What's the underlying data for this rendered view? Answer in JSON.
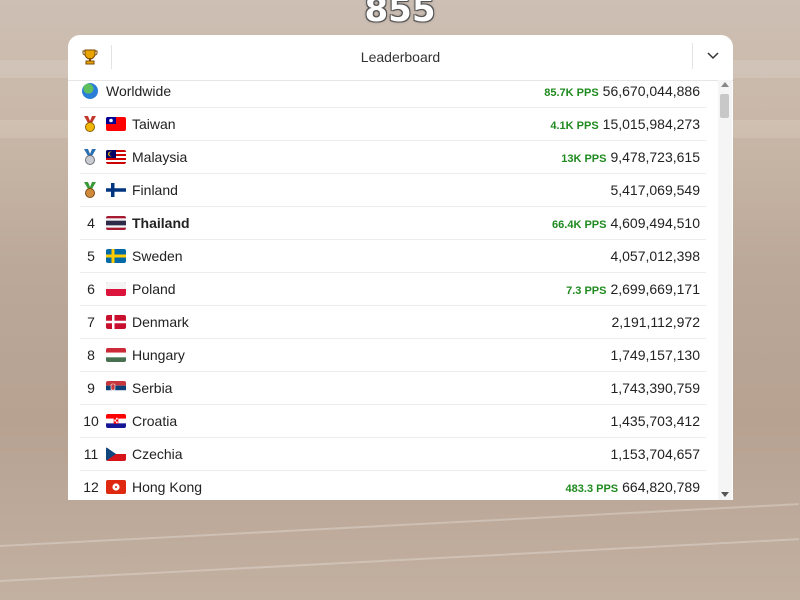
{
  "score": "855",
  "leaderboard": {
    "title": "Leaderboard",
    "icons": {
      "trophy": "trophy-icon",
      "collapse": "chevron-down-icon"
    },
    "colors": {
      "pps": "#1f8a1f"
    },
    "worldwide": {
      "name": "Worldwide",
      "pps": "85.7K PPS",
      "total": "56,670,044,886"
    },
    "rows": [
      {
        "rank": "",
        "medal": "gold",
        "flag": "taiwan",
        "name": "Taiwan",
        "pps": "4.1K PPS",
        "total": "15,015,984,273"
      },
      {
        "rank": "",
        "medal": "silver",
        "flag": "malaysia",
        "name": "Malaysia",
        "pps": "13K PPS",
        "total": "9,478,723,615"
      },
      {
        "rank": "",
        "medal": "bronze",
        "flag": "finland",
        "name": "Finland",
        "pps": "",
        "total": "5,417,069,549"
      },
      {
        "rank": "4",
        "medal": "",
        "flag": "thailand",
        "name": "Thailand",
        "pps": "66.4K PPS",
        "total": "4,609,494,510",
        "bold": true
      },
      {
        "rank": "5",
        "medal": "",
        "flag": "sweden",
        "name": "Sweden",
        "pps": "",
        "total": "4,057,012,398"
      },
      {
        "rank": "6",
        "medal": "",
        "flag": "poland",
        "name": "Poland",
        "pps": "7.3 PPS",
        "total": "2,699,669,171"
      },
      {
        "rank": "7",
        "medal": "",
        "flag": "denmark",
        "name": "Denmark",
        "pps": "",
        "total": "2,191,112,972"
      },
      {
        "rank": "8",
        "medal": "",
        "flag": "hungary",
        "name": "Hungary",
        "pps": "",
        "total": "1,749,157,130"
      },
      {
        "rank": "9",
        "medal": "",
        "flag": "serbia",
        "name": "Serbia",
        "pps": "",
        "total": "1,743,390,759"
      },
      {
        "rank": "10",
        "medal": "",
        "flag": "croatia",
        "name": "Croatia",
        "pps": "",
        "total": "1,435,703,412"
      },
      {
        "rank": "11",
        "medal": "",
        "flag": "czechia",
        "name": "Czechia",
        "pps": "",
        "total": "1,153,704,657"
      },
      {
        "rank": "12",
        "medal": "",
        "flag": "hongkong",
        "name": "Hong Kong",
        "pps": "483.3 PPS",
        "total": "664,820,789"
      }
    ]
  }
}
